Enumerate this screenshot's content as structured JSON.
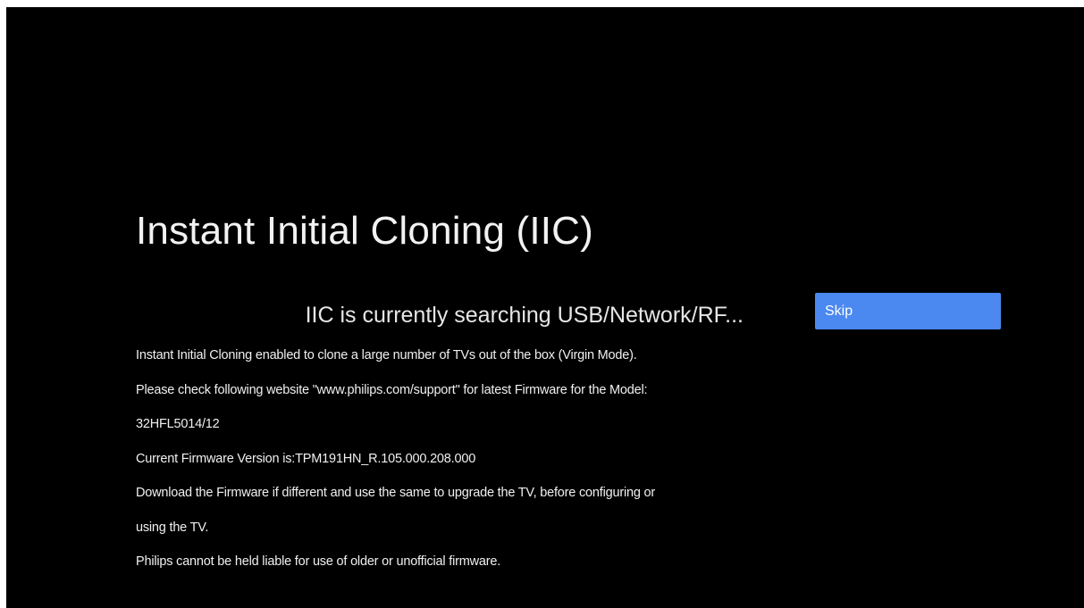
{
  "title": "Instant Initial Cloning (IIC)",
  "status": "IIC is currently searching USB/Network/RF...",
  "skip_label": "Skip",
  "info_lines": [
    "Instant Initial Cloning enabled to clone a large number of TVs out of the box (Virgin Mode).",
    "Please check following website \"www.philips.com/support\" for latest Firmware for the Model:",
    "32HFL5014/12",
    "Current Firmware Version is:TPM191HN_R.105.000.208.000",
    "Download the Firmware if different and use the same to upgrade the TV, before configuring or",
    "using the TV.",
    "Philips cannot be held liable for use of older or unofficial firmware."
  ],
  "colors": {
    "background": "#000000",
    "accent": "#4b88f0",
    "text": "#ffffff"
  }
}
